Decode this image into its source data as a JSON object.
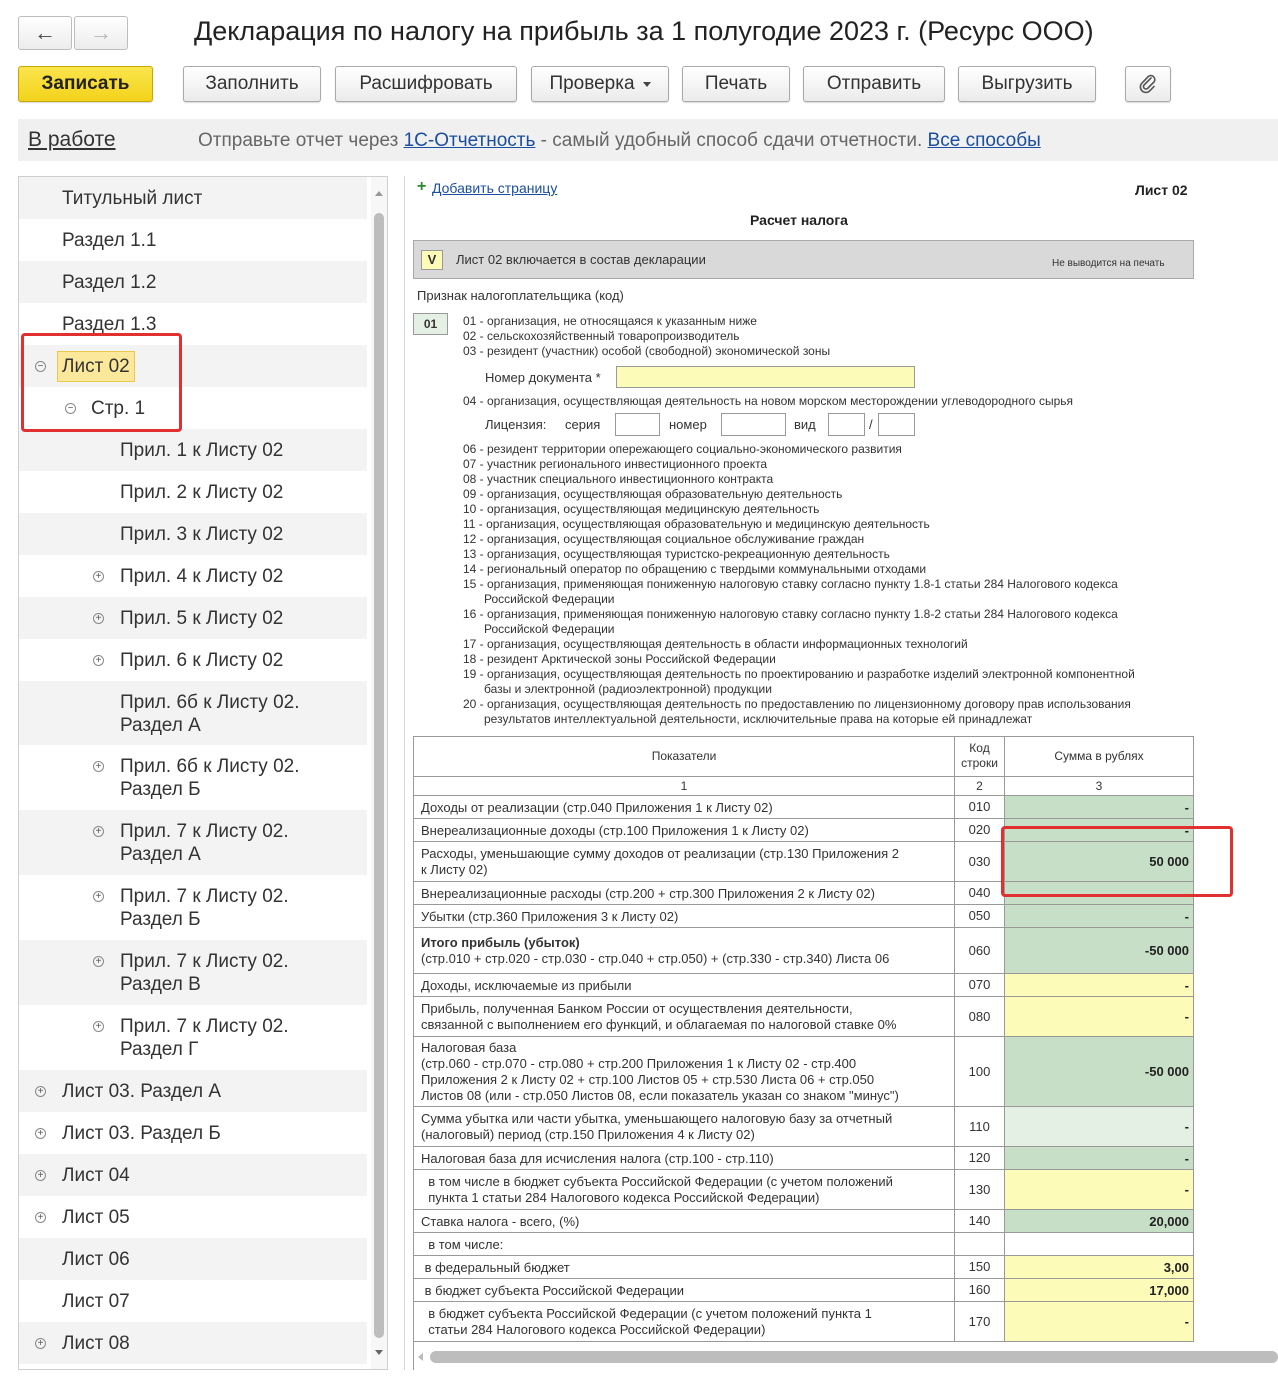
{
  "window": {
    "title": "Декларация по налогу на прибыль за 1 полугодие 2023 г. (Ресурс ООО)",
    "back_icon": "←",
    "forward_icon": "→"
  },
  "toolbar": {
    "save": "Записать",
    "fill": "Заполнить",
    "decode": "Расшифровать",
    "check": "Проверка",
    "print": "Печать",
    "send": "Отправить",
    "export": "Выгрузить",
    "attach_icon": "paperclip-icon"
  },
  "status": {
    "state": "В работе",
    "msg_prefix": "Отправьте отчет через ",
    "msg_link": "1С-Отчетность",
    "msg_suffix": " - самый удобный способ сдачи отчетности. ",
    "all_ways": "Все способы"
  },
  "tree": {
    "items": [
      {
        "label": "Титульный лист"
      },
      {
        "label": "Раздел 1.1"
      },
      {
        "label": "Раздел 1.2"
      },
      {
        "label": "Раздел 1.3"
      },
      {
        "label": "Лист 02"
      },
      {
        "label": "Стр. 1"
      },
      {
        "label": "Прил. 1 к Листу 02"
      },
      {
        "label": "Прил. 2 к Листу 02"
      },
      {
        "label": "Прил. 3 к Листу 02"
      },
      {
        "label": "Прил. 4 к Листу 02"
      },
      {
        "label": "Прил. 5 к Листу 02"
      },
      {
        "label": "Прил. 6 к Листу 02"
      },
      {
        "label": "Прил. 6б к Листу 02.",
        "label2": "Раздел А"
      },
      {
        "label": "Прил. 6б к Листу 02.",
        "label2": "Раздел Б"
      },
      {
        "label": "Прил. 7 к Листу 02.",
        "label2": "Раздел А"
      },
      {
        "label": "Прил. 7 к Листу 02.",
        "label2": "Раздел Б"
      },
      {
        "label": "Прил. 7 к Листу 02.",
        "label2": "Раздел В"
      },
      {
        "label": "Прил. 7 к Листу 02.",
        "label2": "Раздел Г"
      },
      {
        "label": "Лист 03. Раздел А"
      },
      {
        "label": "Лист 03. Раздел Б"
      },
      {
        "label": "Лист 04"
      },
      {
        "label": "Лист 05"
      },
      {
        "label": "Лист 06"
      },
      {
        "label": "Лист 07"
      },
      {
        "label": "Лист 08"
      }
    ]
  },
  "form": {
    "add_page": "Добавить страницу",
    "sheet": "Лист 02",
    "heading": "Расчет налога",
    "include_mark": "V",
    "include_text": "Лист 02 включается в состав декларации",
    "no_print": "Не выводится на печать",
    "taxpayer_label": "Признак налогоплательщика (код)",
    "taxpayer_code": "01",
    "codes_a": [
      "01 - организация, не относящаяся к указанным ниже",
      "02 - сельскохозяйственный товаропроизводитель",
      "03 - резидент (участник) особой (свободной) экономической зоны"
    ],
    "doc_number_label": "Номер документа *",
    "code_04": "04 - организация, осуществляющая деятельность на новом морском месторождении углеводородного сырья",
    "license_label": "Лицензия:",
    "series_label": "серия",
    "number_label": "номер",
    "kind_label": "вид",
    "slash": "/",
    "codes_b": [
      "06 - резидент территории опережающего социально-экономического развития",
      "07 - участник регионального инвестиционного проекта",
      "08 - участник специального инвестиционного контракта",
      "09 - организация, осуществляющая образовательную деятельность",
      "10 - организация, осуществляющая медицинскую деятельность",
      "11 - организация, осуществляющая образовательную и медицинскую деятельность",
      "12 - организация, осуществляющая социальное обслуживание граждан",
      "13 - организация, осуществляющая туристско-рекреационную деятельность",
      "14 - региональный оператор по обращению с твердыми коммунальными отходами",
      "15 - организация, применяющая пониженную налоговую ставку согласно пункту 1.8-1 статьи 284 Налогового кодекса",
      "Российской Федерации",
      "16 - организация, применяющая пониженную налоговую ставку согласно пункту 1.8-2 статьи 284 Налогового кодекса",
      "Российской Федерации",
      "17 - организация, осуществляющая деятельность в области информационных технологий",
      "18 - резидент Арктической зоны Российской Федерации",
      "19 - организация, осуществляющая деятельность по проектированию и разработке изделий электронной компонентной",
      "базы и электронной (радиоэлектронной) продукции",
      "20 - организация, осуществляющая деятельность по предоставлению по лицензионному договору прав использования",
      "результатов интеллектуальной деятельности, исключительные права на которые ей принадлежат"
    ],
    "table": {
      "h_indicator": "Показатели",
      "h_code_1": "Код",
      "h_code_2": "строки",
      "h_sum": "Сумма в рублях",
      "n1": "1",
      "n2": "2",
      "n3": "3",
      "rows": [
        {
          "lines": [
            "Доходы от реализации (стр.040 Приложения 1 к Листу 02)"
          ],
          "code": "010",
          "value": "-",
          "fill": "green"
        },
        {
          "lines": [
            "Внереализационные доходы (стр.100 Приложения 1 к Листу 02)"
          ],
          "code": "020",
          "value": "-",
          "fill": "green"
        },
        {
          "lines": [
            "Расходы, уменьшающие сумму доходов от реализации (стр.130 Приложения 2",
            "к Листу 02)"
          ],
          "code": "030",
          "value": "50 000",
          "fill": "green"
        },
        {
          "lines": [
            "Внереализационные расходы (стр.200 + стр.300 Приложения 2 к Листу 02)"
          ],
          "code": "040",
          "value": "-",
          "fill": "green"
        },
        {
          "lines": [
            "Убытки (стр.360 Приложения 3 к Листу 02)"
          ],
          "code": "050",
          "value": "-",
          "fill": "green"
        },
        {
          "lines": [
            "Итого прибыль (убыток)",
            "(стр.010 + стр.020 - стр.030 - стр.040 + стр.050) + (стр.330 - стр.340) Листа 06"
          ],
          "code": "060",
          "value": "-50 000",
          "fill": "green",
          "bold_first": true
        },
        {
          "lines": [
            "Доходы, исключаемые из прибыли"
          ],
          "code": "070",
          "value": "-",
          "fill": "yellow"
        },
        {
          "lines": [
            "Прибыль, полученная Банком России от осуществления деятельности,",
            "связанной с выполнением его функций, и облагаемая по налоговой ставке 0%"
          ],
          "code": "080",
          "value": "-",
          "fill": "yellow"
        },
        {
          "lines": [
            "Налоговая база",
            "(стр.060 - стр.070 - стр.080 + стр.200 Приложения 1 к Листу 02 - стр.400",
            "Приложения 2 к Листу 02 + стр.100 Листов 05 + стр.530 Листа 06 + стр.050",
            "Листов 08 (или - стр.050 Листов 08, если показатель указан со знаком \"минус\")"
          ],
          "code": "100",
          "value": "-50 000",
          "fill": "green"
        },
        {
          "lines": [
            "Сумма убытка или части убытка, уменьшающего налоговую базу за отчетный",
            "(налоговый) период (стр.150 Приложения 4 к Листу 02)"
          ],
          "code": "110",
          "value": "-",
          "fill": "ltgreen"
        },
        {
          "lines": [
            "Налоговая база для исчисления налога (стр.100 - стр.110)"
          ],
          "code": "120",
          "value": "-",
          "fill": "green"
        },
        {
          "lines": [
            "  в том числе в бюджет субъекта Российской Федерации (с учетом положений",
            "  пункта 1 статьи 284 Налогового кодекса Российской Федерации)"
          ],
          "code": "130",
          "value": "-",
          "fill": "yellow"
        },
        {
          "lines": [
            "Ставка налога - всего, (%)"
          ],
          "code": "140",
          "value": "20,000",
          "fill": "green"
        },
        {
          "lines": [
            "  в том числе:"
          ],
          "code": "",
          "value": "",
          "fill": "none"
        },
        {
          "lines": [
            " в федеральный бюджет"
          ],
          "code": "150",
          "value": "3,00",
          "fill": "yellow"
        },
        {
          "lines": [
            " в бюджет субъекта Российской Федерации"
          ],
          "code": "160",
          "value": "17,000",
          "fill": "yellow"
        },
        {
          "lines": [
            "  в бюджет субъекта Российской Федерации (с учетом положений пункта 1",
            "  статьи 284 Налогового кодекса Российской Федерации)"
          ],
          "code": "170",
          "value": "-",
          "fill": "yellow"
        }
      ]
    }
  }
}
